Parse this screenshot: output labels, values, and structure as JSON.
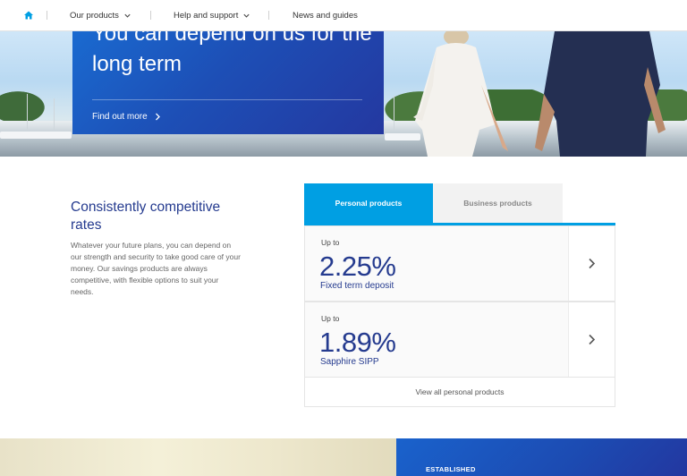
{
  "nav": {
    "home_icon": "home-icon",
    "items": [
      {
        "label": "Our products",
        "has_dropdown": true
      },
      {
        "label": "Help and support",
        "has_dropdown": true
      },
      {
        "label": "News and guides",
        "has_dropdown": false
      }
    ]
  },
  "hero": {
    "title": "You can depend on us for the long term",
    "link_label": "Find out more"
  },
  "rates": {
    "title": "Consistently competitive rates",
    "body": "Whatever your future plans, you can depend on our strength and security to take good care of your money. Our savings products are always competitive, with flexible options to suit your needs.",
    "tabs": [
      {
        "label": "Personal products",
        "active": true
      },
      {
        "label": "Business products",
        "active": false
      }
    ],
    "products": [
      {
        "prefix": "Up to",
        "rate": "2.25%",
        "name": "Fixed term deposit"
      },
      {
        "prefix": "Up to",
        "rate": "1.89%",
        "name": "Sapphire SIPP"
      }
    ],
    "view_all_label": "View all personal products"
  },
  "bottom": {
    "label": "ESTABLISHED"
  },
  "colors": {
    "brand_navy": "#253b8f",
    "accent_blue": "#009fe3",
    "panel_blue": "#1d4fb6"
  }
}
